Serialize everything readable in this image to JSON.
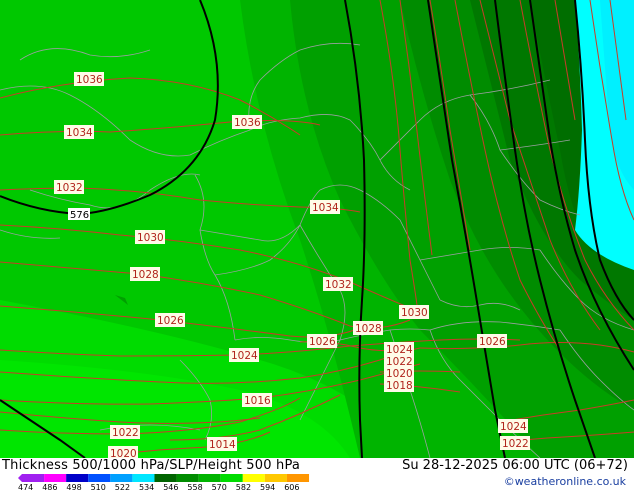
{
  "title": "Thickness 500/1000 hPa/SLP/Height 500 hPa",
  "valid_time": "Su 28-12-2025 06:00 UTC (06+72)",
  "credit": "©weatheronline.co.uk",
  "colorbar": {
    "ticks": [
      "474",
      "486",
      "498",
      "510",
      "522",
      "534",
      "546",
      "558",
      "570",
      "582",
      "594",
      "606"
    ],
    "colors": [
      "#a020f0",
      "#ff00ff",
      "#0000c8",
      "#0050ff",
      "#00a0ff",
      "#00e6ff",
      "#006400",
      "#008c00",
      "#00b400",
      "#00dc00",
      "#ffff00",
      "#ffc800",
      "#ff9600"
    ]
  },
  "isobars": {
    "labels": [
      "1036",
      "1036",
      "1034",
      "1034",
      "1032",
      "1032",
      "1030",
      "1030",
      "1028",
      "1028",
      "1026",
      "1026",
      "1026",
      "1024",
      "1024",
      "1024",
      "1022",
      "1022",
      "1022",
      "1020",
      "1020",
      "1018",
      "1016",
      "1014"
    ]
  },
  "height_labels": [
    "576"
  ],
  "colors": {
    "thickness_534": "#00a000",
    "thickness_540": "#00c800",
    "thickness_546": "#00dc00",
    "thickness_552": "#00f000",
    "thickness_528": "#008c00",
    "thickness_522": "#006e00",
    "thickness_cold": "#00ffff",
    "isobar": "#c83c28",
    "height_contour": "#000000",
    "border": "#9aa0a0"
  }
}
